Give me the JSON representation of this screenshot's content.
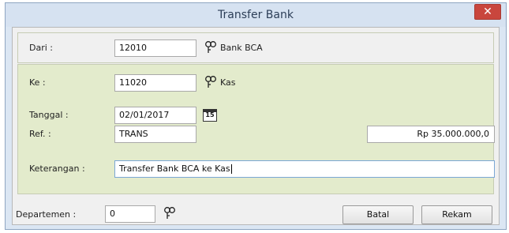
{
  "window": {
    "title": "Transfer Bank"
  },
  "dari": {
    "label": "Dari :",
    "value": "12010",
    "account_name": "Bank BCA"
  },
  "ke": {
    "label": "Ke :",
    "value": "11020",
    "account_name": "Kas"
  },
  "tanggal": {
    "label": "Tanggal :",
    "value": "02/01/2017",
    "calendar_glyph": "15"
  },
  "ref": {
    "label": "Ref. :",
    "value": "TRANS",
    "amount": "Rp 35.000.000,0"
  },
  "keterangan": {
    "label": "Keterangan :",
    "value": "Transfer Bank BCA ke Kas"
  },
  "departemen": {
    "label": "Departemen :",
    "value": "0"
  },
  "buttons": {
    "batal": "Batal",
    "rekam": "Rekam"
  },
  "icons": {
    "close": "close-icon",
    "lookup": "lookup-icon",
    "calendar": "calendar-icon"
  },
  "colors": {
    "panel_background": "#e3ebcc",
    "close_button": "#c9463d"
  }
}
